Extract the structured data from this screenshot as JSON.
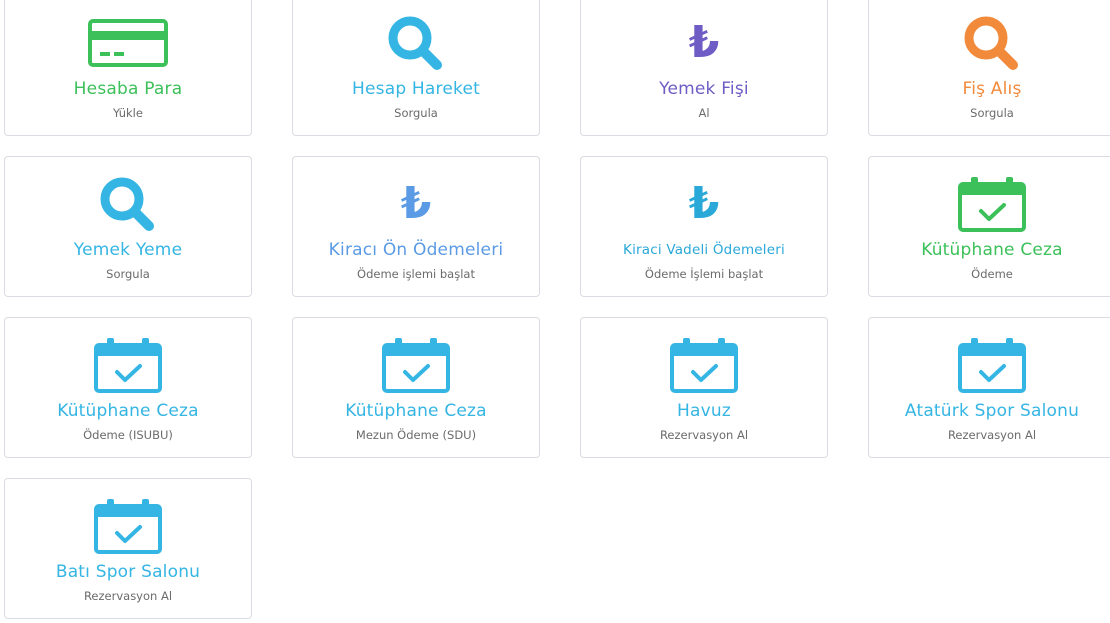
{
  "colors": {
    "green": "#3cc05a",
    "blue": "#34b5e3",
    "purple": "#6f5cc4",
    "orange": "#f28a3c",
    "steelblue": "#5b9be5",
    "teal": "#2aa8d8"
  },
  "cards": [
    {
      "title": "Hesaba Para",
      "subtitle": "Yükle",
      "icon": "credit-card-icon",
      "color": "#3cc05a"
    },
    {
      "title": "Hesap Hareket",
      "subtitle": "Sorgula",
      "icon": "search-icon",
      "color": "#34b5e3"
    },
    {
      "title": "Yemek Fişi",
      "subtitle": "Al",
      "icon": "lira-icon",
      "color": "#6f5cc4"
    },
    {
      "title": "Fiş Alış",
      "subtitle": "Sorgula",
      "icon": "search-icon",
      "color": "#f28a3c"
    },
    {
      "title": "Yemek Yeme",
      "subtitle": "Sorgula",
      "icon": "search-icon",
      "color": "#34b5e3"
    },
    {
      "title": "Kiracı Ön Ödemeleri",
      "subtitle": "Ödeme işlemi başlat",
      "icon": "lira-icon",
      "color": "#5b9be5"
    },
    {
      "title": "Kiraci Vadeli Ödemeleri",
      "subtitle": "Ödeme İşlemi başlat",
      "icon": "lira-icon",
      "color": "#2aa8d8"
    },
    {
      "title": "Kütüphane Ceza",
      "subtitle": "Ödeme",
      "icon": "calendar-check-icon",
      "color": "#3cc05a"
    },
    {
      "title": "Kütüphane Ceza",
      "subtitle": "Ödeme (ISUBU)",
      "icon": "calendar-check-icon",
      "color": "#34b5e3"
    },
    {
      "title": "Kütüphane Ceza",
      "subtitle": "Mezun Ödeme (SDU)",
      "icon": "calendar-check-icon",
      "color": "#34b5e3"
    },
    {
      "title": "Havuz",
      "subtitle": "Rezervasyon Al",
      "icon": "calendar-check-icon",
      "color": "#34b5e3"
    },
    {
      "title": "Atatürk Spor Salonu",
      "subtitle": "Rezervasyon Al",
      "icon": "calendar-check-icon",
      "color": "#34b5e3"
    },
    {
      "title": "Batı Spor Salonu",
      "subtitle": "Rezervasyon Al",
      "icon": "calendar-check-icon",
      "color": "#34b5e3"
    }
  ]
}
